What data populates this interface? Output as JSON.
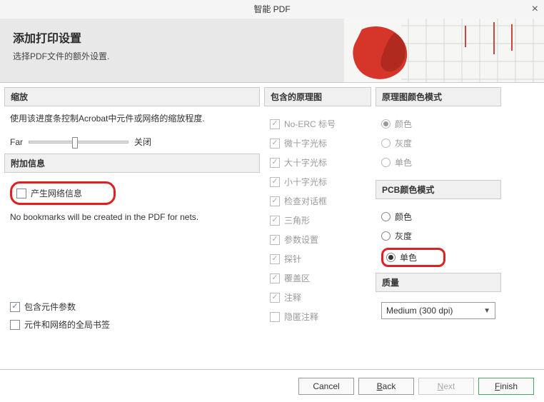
{
  "title": "智能 PDF",
  "header": {
    "title": "添加打印设置",
    "subtitle": "选择PDF文件的额外设置."
  },
  "zoom": {
    "heading": "缩放",
    "desc": "使用该进度条控制Acrobat中元件或网络的缩放程度.",
    "slider_left": "Far",
    "slider_right": "关闭"
  },
  "addl": {
    "heading": "附加信息",
    "gen_nets": "产生网络信息",
    "gen_nets_note": "No bookmarks will be created in the PDF for nets.",
    "include_params": "包含元件参数",
    "global_bookmarks": "元件和网络的全局书签"
  },
  "include": {
    "heading": "包含的原理图",
    "items": [
      "No-ERC 标号",
      "微十字光标",
      "大十字光标",
      "小十字光标",
      "检查对话框",
      "三角形",
      "参数设置",
      "探针",
      "覆盖区",
      "注释",
      "隐匿注释"
    ]
  },
  "sch_colors": {
    "heading": "原理图颜色模式",
    "color": "颜色",
    "gray": "灰度",
    "mono": "单色"
  },
  "pcb_colors": {
    "heading": "PCB颜色模式",
    "color": "颜色",
    "gray": "灰度",
    "mono": "单色"
  },
  "quality": {
    "heading": "质量",
    "value": "Medium (300 dpi)"
  },
  "footer": {
    "cancel": "Cancel",
    "back": "Back",
    "next": "Next",
    "finish": "Finish"
  }
}
